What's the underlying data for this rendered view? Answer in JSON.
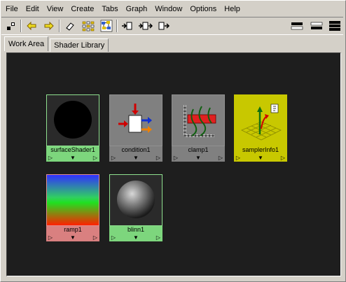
{
  "menubar": {
    "items": [
      "File",
      "Edit",
      "View",
      "Create",
      "Tabs",
      "Graph",
      "Window",
      "Options",
      "Help"
    ]
  },
  "toolbar": {
    "buttons": [
      "node-layout-icon",
      "arrow-left-icon",
      "arrow-right-icon",
      "eraser-icon",
      "grid-select-icon",
      "graph-network-icon",
      "input-connections-icon",
      "input-output-connections-icon",
      "output-connections-icon",
      "view-mode-single-icon",
      "view-mode-double-icon",
      "view-mode-triple-icon"
    ]
  },
  "tabs": {
    "work_area": "Work Area",
    "shader_library": "Shader Library"
  },
  "nodes": [
    {
      "name": "surfaceShader1",
      "type": "surfaceShader",
      "label_color": "#7dd67d",
      "border_color": "#8fe08f"
    },
    {
      "name": "condition1",
      "type": "condition",
      "label_color": "#808080",
      "border_color": "#909090"
    },
    {
      "name": "clamp1",
      "type": "clamp",
      "label_color": "#808080",
      "border_color": "#909090"
    },
    {
      "name": "samplerInfo1",
      "type": "samplerInfo",
      "label_color": "#c8c800",
      "border_color": "#c8c800"
    },
    {
      "name": "ramp1",
      "type": "ramp",
      "label_color": "#d98080",
      "border_color": "#e09090"
    },
    {
      "name": "blinn1",
      "type": "blinn",
      "label_color": "#7dd67d",
      "border_color": "#8fe08f"
    }
  ],
  "port_glyphs": {
    "in": "▷",
    "mid": "▼",
    "out": "▷"
  },
  "colors": {
    "background": "#d4d0c8",
    "work_area_bg": "#1e1e1e"
  }
}
